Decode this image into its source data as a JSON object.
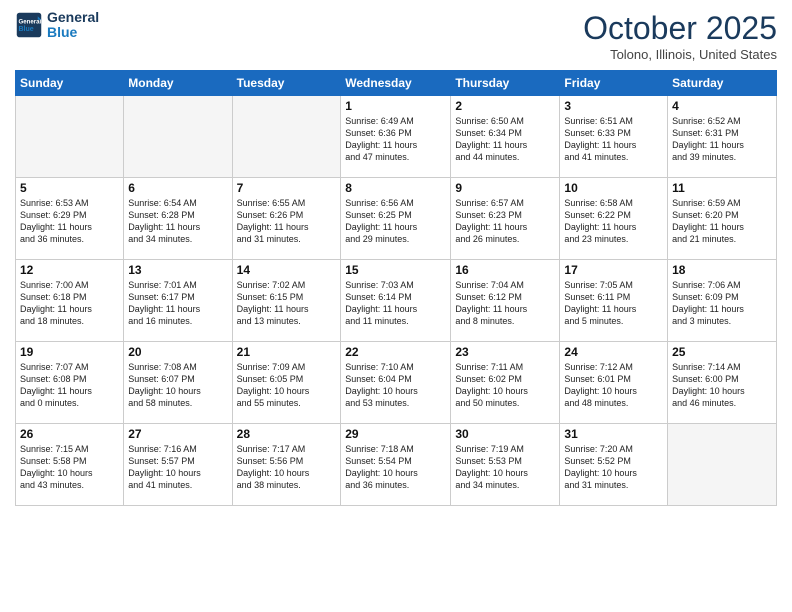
{
  "header": {
    "logo_line1": "General",
    "logo_line2": "Blue",
    "month": "October 2025",
    "location": "Tolono, Illinois, United States"
  },
  "weekdays": [
    "Sunday",
    "Monday",
    "Tuesday",
    "Wednesday",
    "Thursday",
    "Friday",
    "Saturday"
  ],
  "weeks": [
    [
      {
        "day": "",
        "info": ""
      },
      {
        "day": "",
        "info": ""
      },
      {
        "day": "",
        "info": ""
      },
      {
        "day": "1",
        "info": "Sunrise: 6:49 AM\nSunset: 6:36 PM\nDaylight: 11 hours\nand 47 minutes."
      },
      {
        "day": "2",
        "info": "Sunrise: 6:50 AM\nSunset: 6:34 PM\nDaylight: 11 hours\nand 44 minutes."
      },
      {
        "day": "3",
        "info": "Sunrise: 6:51 AM\nSunset: 6:33 PM\nDaylight: 11 hours\nand 41 minutes."
      },
      {
        "day": "4",
        "info": "Sunrise: 6:52 AM\nSunset: 6:31 PM\nDaylight: 11 hours\nand 39 minutes."
      }
    ],
    [
      {
        "day": "5",
        "info": "Sunrise: 6:53 AM\nSunset: 6:29 PM\nDaylight: 11 hours\nand 36 minutes."
      },
      {
        "day": "6",
        "info": "Sunrise: 6:54 AM\nSunset: 6:28 PM\nDaylight: 11 hours\nand 34 minutes."
      },
      {
        "day": "7",
        "info": "Sunrise: 6:55 AM\nSunset: 6:26 PM\nDaylight: 11 hours\nand 31 minutes."
      },
      {
        "day": "8",
        "info": "Sunrise: 6:56 AM\nSunset: 6:25 PM\nDaylight: 11 hours\nand 29 minutes."
      },
      {
        "day": "9",
        "info": "Sunrise: 6:57 AM\nSunset: 6:23 PM\nDaylight: 11 hours\nand 26 minutes."
      },
      {
        "day": "10",
        "info": "Sunrise: 6:58 AM\nSunset: 6:22 PM\nDaylight: 11 hours\nand 23 minutes."
      },
      {
        "day": "11",
        "info": "Sunrise: 6:59 AM\nSunset: 6:20 PM\nDaylight: 11 hours\nand 21 minutes."
      }
    ],
    [
      {
        "day": "12",
        "info": "Sunrise: 7:00 AM\nSunset: 6:18 PM\nDaylight: 11 hours\nand 18 minutes."
      },
      {
        "day": "13",
        "info": "Sunrise: 7:01 AM\nSunset: 6:17 PM\nDaylight: 11 hours\nand 16 minutes."
      },
      {
        "day": "14",
        "info": "Sunrise: 7:02 AM\nSunset: 6:15 PM\nDaylight: 11 hours\nand 13 minutes."
      },
      {
        "day": "15",
        "info": "Sunrise: 7:03 AM\nSunset: 6:14 PM\nDaylight: 11 hours\nand 11 minutes."
      },
      {
        "day": "16",
        "info": "Sunrise: 7:04 AM\nSunset: 6:12 PM\nDaylight: 11 hours\nand 8 minutes."
      },
      {
        "day": "17",
        "info": "Sunrise: 7:05 AM\nSunset: 6:11 PM\nDaylight: 11 hours\nand 5 minutes."
      },
      {
        "day": "18",
        "info": "Sunrise: 7:06 AM\nSunset: 6:09 PM\nDaylight: 11 hours\nand 3 minutes."
      }
    ],
    [
      {
        "day": "19",
        "info": "Sunrise: 7:07 AM\nSunset: 6:08 PM\nDaylight: 11 hours\nand 0 minutes."
      },
      {
        "day": "20",
        "info": "Sunrise: 7:08 AM\nSunset: 6:07 PM\nDaylight: 10 hours\nand 58 minutes."
      },
      {
        "day": "21",
        "info": "Sunrise: 7:09 AM\nSunset: 6:05 PM\nDaylight: 10 hours\nand 55 minutes."
      },
      {
        "day": "22",
        "info": "Sunrise: 7:10 AM\nSunset: 6:04 PM\nDaylight: 10 hours\nand 53 minutes."
      },
      {
        "day": "23",
        "info": "Sunrise: 7:11 AM\nSunset: 6:02 PM\nDaylight: 10 hours\nand 50 minutes."
      },
      {
        "day": "24",
        "info": "Sunrise: 7:12 AM\nSunset: 6:01 PM\nDaylight: 10 hours\nand 48 minutes."
      },
      {
        "day": "25",
        "info": "Sunrise: 7:14 AM\nSunset: 6:00 PM\nDaylight: 10 hours\nand 46 minutes."
      }
    ],
    [
      {
        "day": "26",
        "info": "Sunrise: 7:15 AM\nSunset: 5:58 PM\nDaylight: 10 hours\nand 43 minutes."
      },
      {
        "day": "27",
        "info": "Sunrise: 7:16 AM\nSunset: 5:57 PM\nDaylight: 10 hours\nand 41 minutes."
      },
      {
        "day": "28",
        "info": "Sunrise: 7:17 AM\nSunset: 5:56 PM\nDaylight: 10 hours\nand 38 minutes."
      },
      {
        "day": "29",
        "info": "Sunrise: 7:18 AM\nSunset: 5:54 PM\nDaylight: 10 hours\nand 36 minutes."
      },
      {
        "day": "30",
        "info": "Sunrise: 7:19 AM\nSunset: 5:53 PM\nDaylight: 10 hours\nand 34 minutes."
      },
      {
        "day": "31",
        "info": "Sunrise: 7:20 AM\nSunset: 5:52 PM\nDaylight: 10 hours\nand 31 minutes."
      },
      {
        "day": "",
        "info": ""
      }
    ]
  ]
}
